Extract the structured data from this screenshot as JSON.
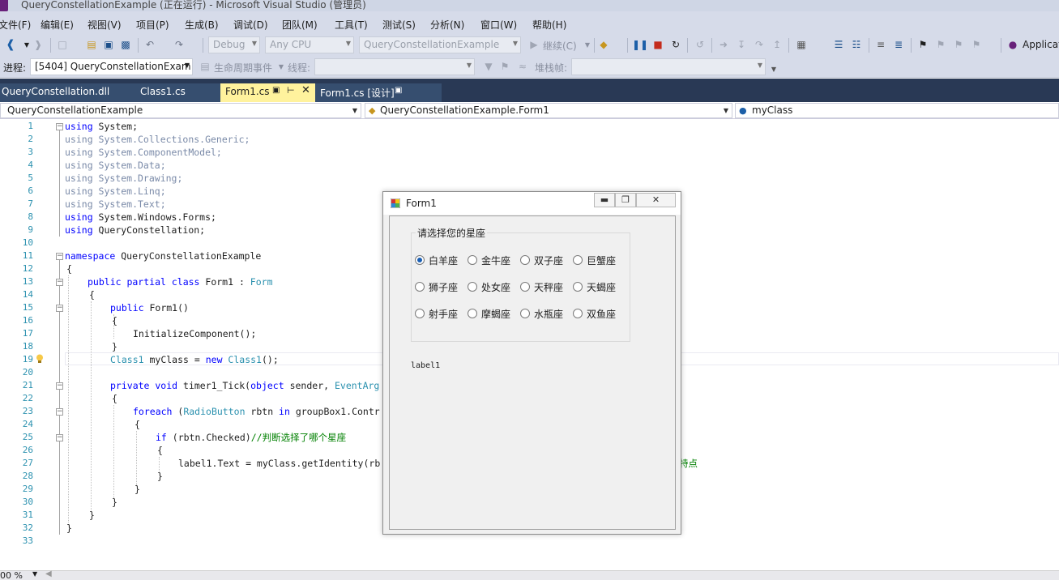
{
  "window": {
    "title": "QueryConstellationExample (正在运行) - Microsoft Visual Studio (管理员)"
  },
  "menu": [
    "文件(F)",
    "编辑(E)",
    "视图(V)",
    "项目(P)",
    "生成(B)",
    "调试(D)",
    "团队(M)",
    "工具(T)",
    "测试(S)",
    "分析(N)",
    "窗口(W)",
    "帮助(H)"
  ],
  "toolbar": {
    "config": "Debug",
    "platform": "Any CPU",
    "startup_project": "QueryConstellationExample",
    "continue_label": "继续(C)",
    "application_insights": "Applicati"
  },
  "debug_toolbar": {
    "process_label": "进程:",
    "process_value": "[5404] QueryConstellationExam",
    "lifecycle_label": "生命周期事件",
    "thread_label": "线程:",
    "stackframe_label": "堆栈帧:"
  },
  "tabs": [
    "QueryConstellation.dll",
    "Class1.cs",
    "Form1.cs",
    "Form1.cs [设计]"
  ],
  "nav": {
    "project": "QueryConstellationExample",
    "type": "QueryConstellationExample.Form1",
    "member": "myClass"
  },
  "code": {
    "line_numbers": [
      "1",
      "2",
      "3",
      "4",
      "5",
      "6",
      "7",
      "8",
      "9",
      "10",
      "11",
      "12",
      "13",
      "14",
      "15",
      "16",
      "17",
      "18",
      "19",
      "20",
      "21",
      "22",
      "23",
      "24",
      "25",
      "26",
      "27",
      "28",
      "29",
      "30",
      "31",
      "32",
      "33"
    ],
    "l1_kw": "using",
    "l1_rest": " System;",
    "l2": "using System.Collections.Generic;",
    "l3": "using System.ComponentModel;",
    "l4": "using System.Data;",
    "l5": "using System.Drawing;",
    "l6": "using System.Linq;",
    "l7": "using System.Text;",
    "l8_kw": "using",
    "l8_rest": " System.Windows.Forms;",
    "l9_kw": "using",
    "l9_rest": " QueryConstellation;",
    "l11_kw": "namespace",
    "l11_rest": " QueryConstellationExample",
    "l12": "{",
    "l13_kw": "public partial class",
    "l13_mid": " Form1 : ",
    "l13_ty": "Form",
    "l14": "{",
    "l15_kw": "public",
    "l15_rest": " Form1()",
    "l16": "{",
    "l17": "InitializeComponent();",
    "l18": "}",
    "l19_ty": "Class1",
    "l19_mid": " myClass = ",
    "l19_kw": "new",
    "l19_ty2": " Class1",
    "l19_end": "();",
    "l21_kw": "private void",
    "l21_mid": " timer1_Tick(",
    "l21_kw2": "object",
    "l21_mid2": " sender, ",
    "l21_ty": "EventArg",
    "l22": "{",
    "l23_kw": "foreach",
    "l23_mid": " (",
    "l23_ty": "RadioButton",
    "l23_mid2": " rbtn ",
    "l23_kw2": "in",
    "l23_end": " groupBox1.Contr",
    "l24": "{",
    "l25_kw": "if",
    "l25_mid": " (rbtn.Checked)",
    "l25_cm": "//判断选择了哪个星座",
    "l26": "{",
    "l27": "label1.Text = myClass.getIdentity(rb",
    "l27_tail": "特点",
    "l28": "}",
    "l29": "}",
    "l30": "}",
    "l31": "}",
    "l32": "}"
  },
  "form1": {
    "title": "Form1",
    "group_title": "请选择您的星座",
    "radios": [
      "白羊座",
      "金牛座",
      "双子座",
      "巨蟹座",
      "狮子座",
      "处女座",
      "天秤座",
      "天蝎座",
      "射手座",
      "摩蝎座",
      "水瓶座",
      "双鱼座"
    ],
    "selected": "白羊座",
    "label1": "label1"
  },
  "status": {
    "zoom": "00 %"
  }
}
